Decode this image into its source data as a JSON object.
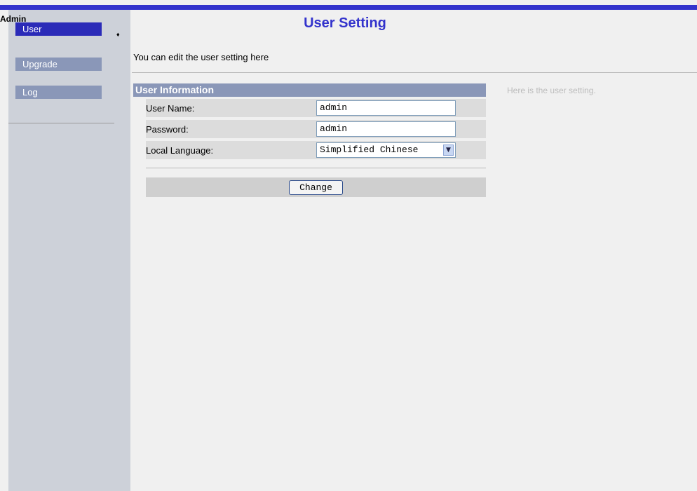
{
  "sidebar": {
    "title": "Admin",
    "items": [
      {
        "label": "User",
        "active": true
      },
      {
        "label": "Upgrade",
        "active": false
      },
      {
        "label": "Log",
        "active": false
      }
    ],
    "active_marker": "♦"
  },
  "main": {
    "title": "User Setting",
    "subtitle": "You can edit the user setting here",
    "section_title": "User Information",
    "fields": {
      "username": {
        "label": "User Name:",
        "value": "admin"
      },
      "password": {
        "label": "Password:",
        "value": "admin"
      },
      "language": {
        "label": "Local Language:",
        "value": "Simplified Chinese"
      }
    },
    "change_label": "Change",
    "help_text": "Here is the user setting."
  },
  "colors": {
    "accent": "#3333cc",
    "nav_active": "#2b2bb8",
    "nav_inactive": "#8a97b8",
    "sidebar_bg": "#cdd1d9"
  }
}
